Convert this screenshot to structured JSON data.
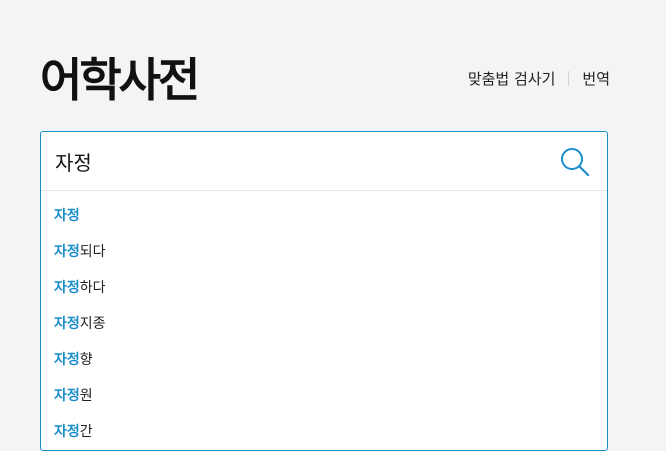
{
  "header": {
    "logo": "어학사전",
    "nav": [
      {
        "label": "맞춤법 검사기"
      },
      {
        "label": "번역"
      }
    ]
  },
  "search": {
    "query": "자정"
  },
  "suggestions": [
    {
      "match": "자정",
      "rest": ""
    },
    {
      "match": "자정",
      "rest": "되다"
    },
    {
      "match": "자정",
      "rest": "하다"
    },
    {
      "match": "자정",
      "rest": "지종"
    },
    {
      "match": "자정",
      "rest": "향"
    },
    {
      "match": "자정",
      "rest": "원"
    },
    {
      "match": "자정",
      "rest": "간"
    }
  ],
  "colors": {
    "accent": "#1a8ecb",
    "background": "#f3f4f6"
  },
  "icons": {
    "search": "search-icon"
  }
}
